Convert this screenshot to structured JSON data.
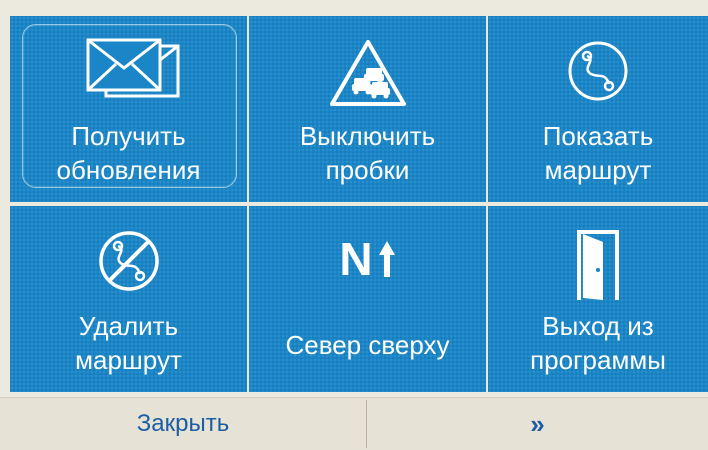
{
  "menu": {
    "tiles": [
      {
        "lines": [
          "Получить",
          "обновления"
        ],
        "icon": "envelopes-icon"
      },
      {
        "lines": [
          "Выключить",
          "пробки"
        ],
        "icon": "traffic-jam-sign-icon"
      },
      {
        "lines": [
          "Показать",
          "маршрут"
        ],
        "icon": "route-icon"
      },
      {
        "lines": [
          "Удалить",
          "маршрут"
        ],
        "icon": "delete-route-icon"
      },
      {
        "lines": [
          "Север сверху"
        ],
        "icon": "north-up-icon",
        "icon_text": "N"
      },
      {
        "lines": [
          "Выход из",
          "программы"
        ],
        "icon": "exit-door-icon"
      }
    ]
  },
  "bottom_bar": {
    "close_label": "Закрыть",
    "next_label": "»"
  },
  "colors": {
    "tile": "#1a86c7",
    "background": "#ece9de",
    "bottom_text": "#1b5ea4"
  }
}
